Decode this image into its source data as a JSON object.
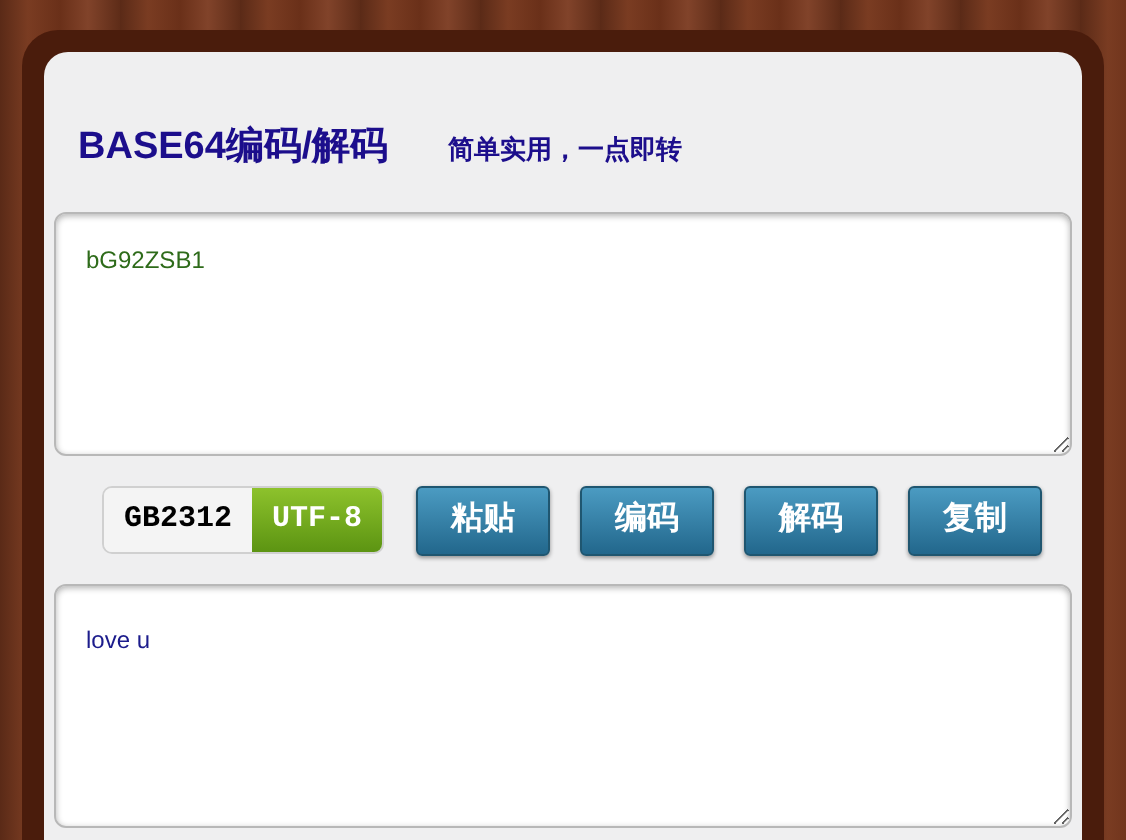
{
  "header": {
    "title": "BASE64编码/解码",
    "subtitle": "简单实用，一点即转"
  },
  "input": {
    "value": "bG92ZSB1"
  },
  "encodings": [
    {
      "label": "GB2312",
      "selected": false
    },
    {
      "label": "UTF-8",
      "selected": true
    }
  ],
  "buttons": [
    "粘贴",
    "编码",
    "解码",
    "复制"
  ],
  "output": {
    "value": "love u"
  }
}
